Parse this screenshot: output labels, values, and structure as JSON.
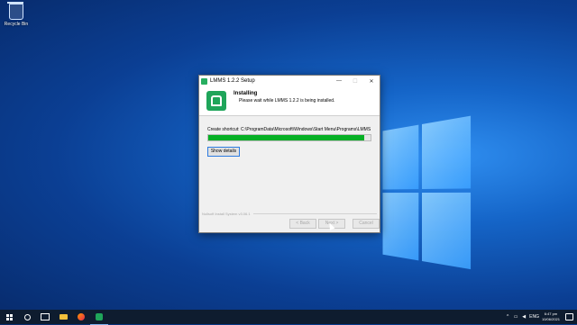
{
  "desktop": {
    "recycle_bin_label": "Recycle Bin"
  },
  "window": {
    "title": "LMMS 1.2.2 Setup",
    "header_title": "Installing",
    "header_subtitle": "Please wait while LMMS 1.2.2 is being installed.",
    "status_text": "Create shortcut: C:\\ProgramData\\Microsoft\\Windows\\Start Menu\\Programs\\LMMS 1.2.2\\LMMS",
    "progress_fraction": 0.96,
    "show_details_label": "Show details",
    "branding": "Nullsoft Install System v3.06.1",
    "back_label": "< Back",
    "next_label": "Next >",
    "cancel_label": "Cancel",
    "minimize_glyph": "—",
    "maximize_glyph": "☐",
    "close_glyph": "✕"
  },
  "taskbar": {
    "apps": [
      "windows-start",
      "search",
      "task-view",
      "file-explorer",
      "firefox",
      "lmms"
    ],
    "tray": {
      "up_arrow": "^",
      "language": "ENG",
      "time": "6:47 pm",
      "date": "10/06/2021"
    }
  },
  "colors": {
    "progress": "#06b025",
    "accent": "#2d7be0",
    "taskbar": "#0e1c2f"
  }
}
